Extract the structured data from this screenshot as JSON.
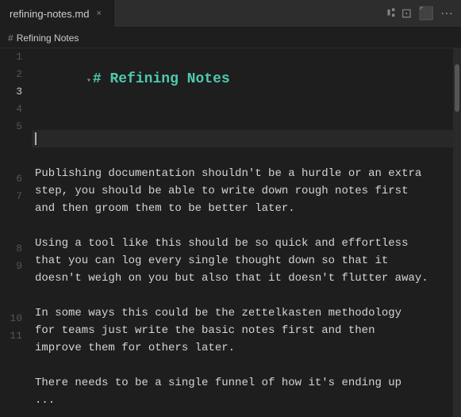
{
  "tab": {
    "filename": "refining-notes.md",
    "close_label": "×"
  },
  "breadcrumb": {
    "hash": "#",
    "title": "Refining Notes"
  },
  "toolbar": {
    "icons": [
      "⑆",
      "⊡",
      "⬜",
      "⋯"
    ]
  },
  "editor": {
    "lines": [
      {
        "number": 1,
        "type": "heading",
        "content": "# Refining Notes",
        "has_chevron": true
      },
      {
        "number": 2,
        "type": "empty",
        "content": ""
      },
      {
        "number": 3,
        "type": "cursor",
        "content": ""
      },
      {
        "number": 4,
        "type": "empty",
        "content": ""
      },
      {
        "number": 5,
        "type": "paragraph",
        "content": "Publishing documentation shouldn't be a hurdle or an extra\nstep, you should be able to write down rough notes first\nand then groom them to be better later."
      },
      {
        "number": 6,
        "type": "empty",
        "content": ""
      },
      {
        "number": 7,
        "type": "paragraph",
        "content": "Using a tool like this should be so quick and effortless\nthat you can log every single thought down so that it\ndoesn't weigh on you but also that it doesn't flutter away."
      },
      {
        "number": 8,
        "type": "empty",
        "content": ""
      },
      {
        "number": 9,
        "type": "paragraph",
        "content": "In some ways this could be the zettelkasten methodology\nfor teams just write the basic notes first and then\nimprove them for others later."
      },
      {
        "number": 10,
        "type": "empty",
        "content": ""
      },
      {
        "number": 11,
        "type": "paragraph",
        "content": "There needs to be a single funnel of how it's ending up\n..."
      }
    ]
  }
}
